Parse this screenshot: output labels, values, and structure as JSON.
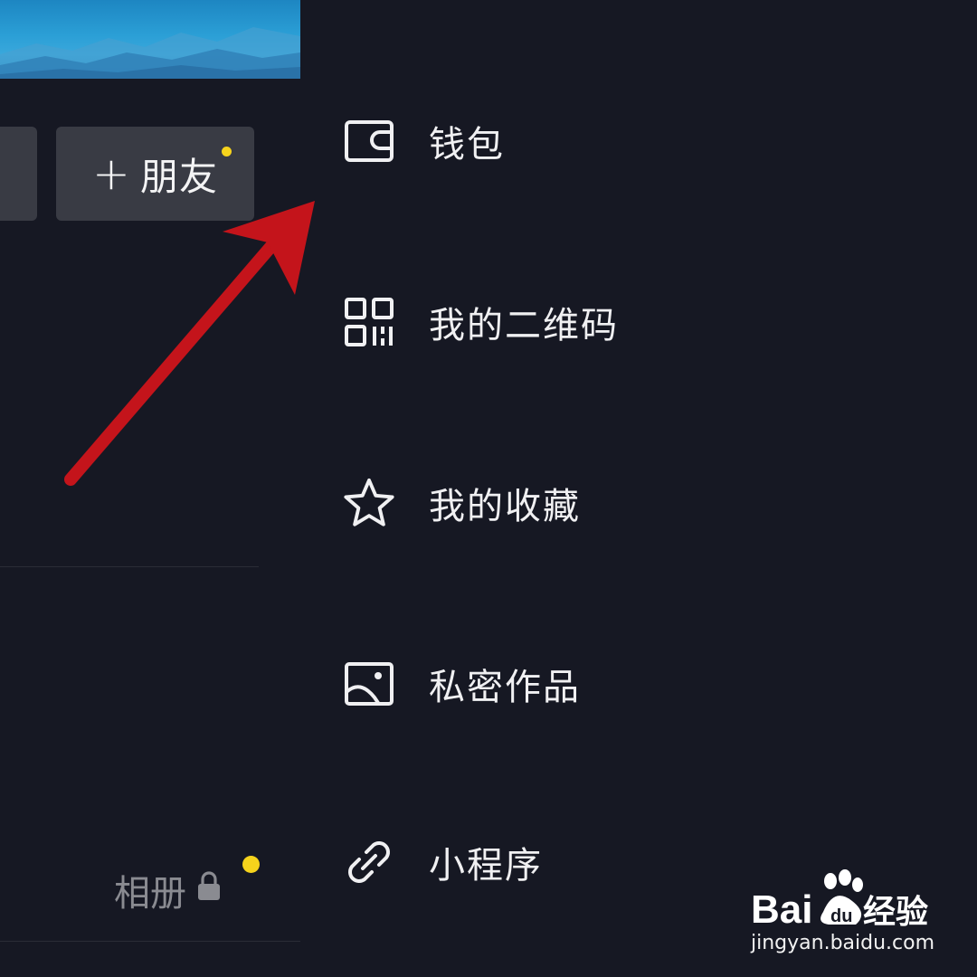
{
  "profile": {
    "add_friend_label": "朋友",
    "add_friend_plus": "+",
    "album_label": "相册"
  },
  "drawer": {
    "items": [
      {
        "label": "钱包",
        "icon": "wallet-icon"
      },
      {
        "label": "我的二维码",
        "icon": "qr-code-icon"
      },
      {
        "label": "我的收藏",
        "icon": "star-icon"
      },
      {
        "label": "私密作品",
        "icon": "image-icon"
      },
      {
        "label": "小程序",
        "icon": "link-icon"
      }
    ]
  },
  "watermark": {
    "brand": "Bai",
    "brand_cn": "经验",
    "url": "jingyan.baidu.com"
  },
  "colors": {
    "background": "#161823",
    "button": "#393b44",
    "badge": "#f6d31c",
    "arrow": "#c4141b"
  }
}
